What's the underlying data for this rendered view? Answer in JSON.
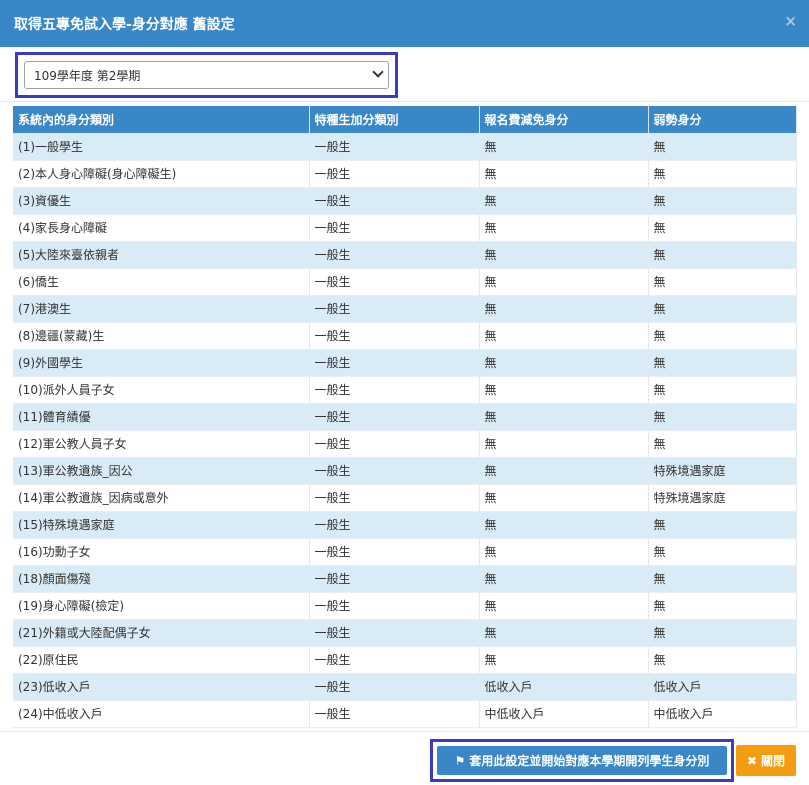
{
  "dialog": {
    "title": "取得五專免試入學-身分對應 舊設定",
    "close_glyph": "×"
  },
  "semester_select": {
    "selected": "109學年度 第2學期"
  },
  "table": {
    "headers": [
      "系統內的身分類別",
      "特種生加分類別",
      "報名費減免身分",
      "弱勢身分"
    ],
    "rows": [
      [
        "(1)一般學生",
        "一般生",
        "無",
        "無"
      ],
      [
        "(2)本人身心障礙(身心障礙生)",
        "一般生",
        "無",
        "無"
      ],
      [
        "(3)資優生",
        "一般生",
        "無",
        "無"
      ],
      [
        "(4)家長身心障礙",
        "一般生",
        "無",
        "無"
      ],
      [
        "(5)大陸來臺依親者",
        "一般生",
        "無",
        "無"
      ],
      [
        "(6)僑生",
        "一般生",
        "無",
        "無"
      ],
      [
        "(7)港澳生",
        "一般生",
        "無",
        "無"
      ],
      [
        "(8)邊疆(蒙藏)生",
        "一般生",
        "無",
        "無"
      ],
      [
        "(9)外國學生",
        "一般生",
        "無",
        "無"
      ],
      [
        "(10)派外人員子女",
        "一般生",
        "無",
        "無"
      ],
      [
        "(11)體育績優",
        "一般生",
        "無",
        "無"
      ],
      [
        "(12)軍公教人員子女",
        "一般生",
        "無",
        "無"
      ],
      [
        "(13)軍公教遺族_因公",
        "一般生",
        "無",
        "特殊境遇家庭"
      ],
      [
        "(14)軍公教遺族_因病或意外",
        "一般生",
        "無",
        "特殊境遇家庭"
      ],
      [
        "(15)特殊境遇家庭",
        "一般生",
        "無",
        "無"
      ],
      [
        "(16)功勳子女",
        "一般生",
        "無",
        "無"
      ],
      [
        "(18)顏面傷殘",
        "一般生",
        "無",
        "無"
      ],
      [
        "(19)身心障礙(檢定)",
        "一般生",
        "無",
        "無"
      ],
      [
        "(21)外籍或大陸配偶子女",
        "一般生",
        "無",
        "無"
      ],
      [
        "(22)原住民",
        "一般生",
        "無",
        "無"
      ],
      [
        "(23)低收入戶",
        "一般生",
        "低收入戶",
        "低收入戶"
      ],
      [
        "(24)中低收入戶",
        "一般生",
        "中低收入戶",
        "中低收入戶"
      ]
    ]
  },
  "buttons": {
    "apply_label": "套用此設定並開始對應本學期開列學生身分別",
    "apply_icon": "flag-icon",
    "close_label": "關閉",
    "close_icon": "x-icon"
  },
  "colors": {
    "header_blue": "#3a87c8",
    "stripe": "#d9ebf7",
    "highlight_border": "#3b3bbf",
    "close_orange": "#f39c12"
  }
}
